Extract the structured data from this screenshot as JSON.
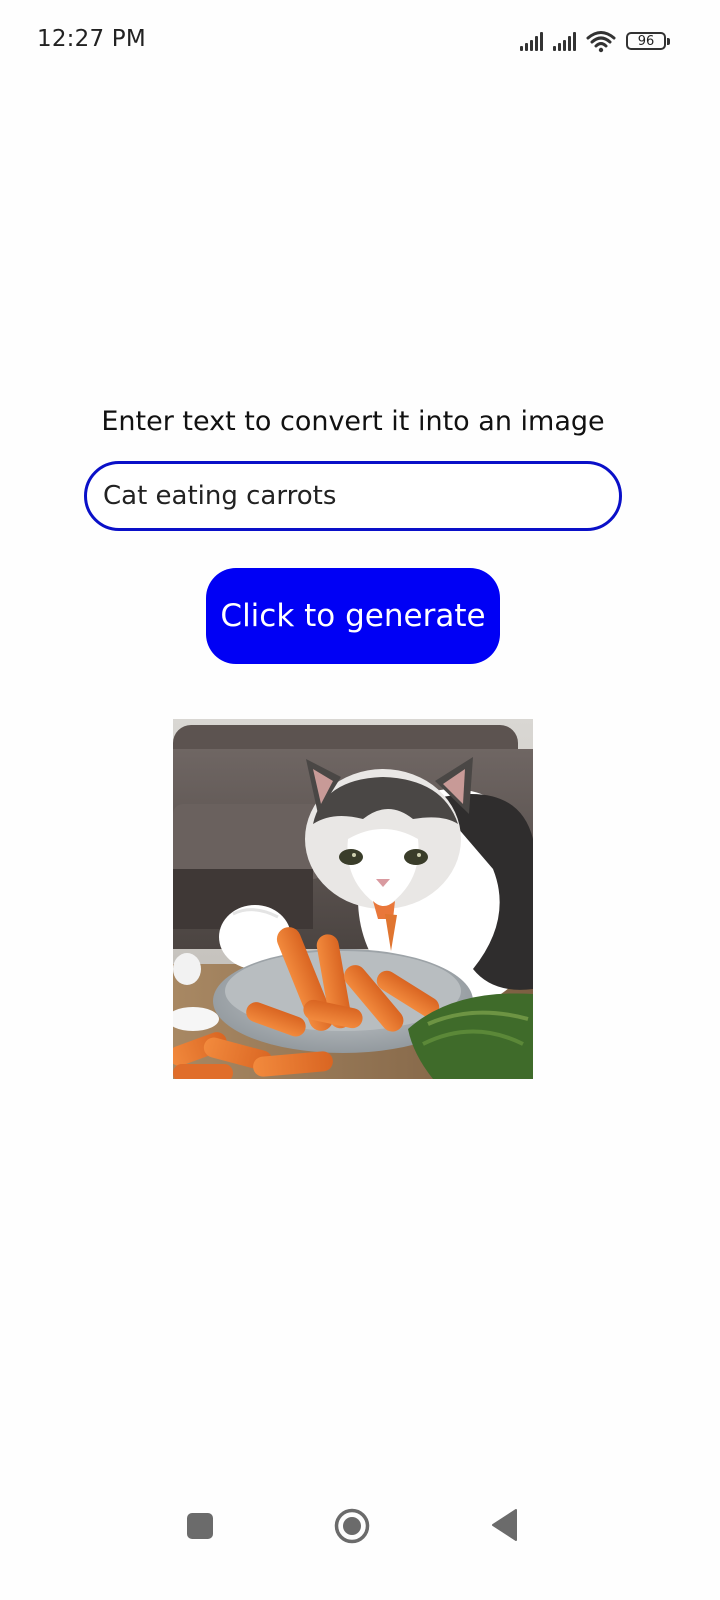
{
  "status_bar": {
    "time": "12:27 PM",
    "battery": "96",
    "icons": [
      "signal-icon",
      "signal-icon",
      "wifi-icon",
      "battery-icon"
    ]
  },
  "main": {
    "prompt_label": "Enter text to convert it into an image",
    "input_value": "Cat eating carrots",
    "generate_label": "Click to generate",
    "image_alt": "generated-image"
  },
  "nav_bar": {
    "icons": [
      "recents-icon",
      "home-icon",
      "back-icon"
    ]
  },
  "colors": {
    "accent": "#0000f5",
    "input_border": "#0a10c8"
  }
}
